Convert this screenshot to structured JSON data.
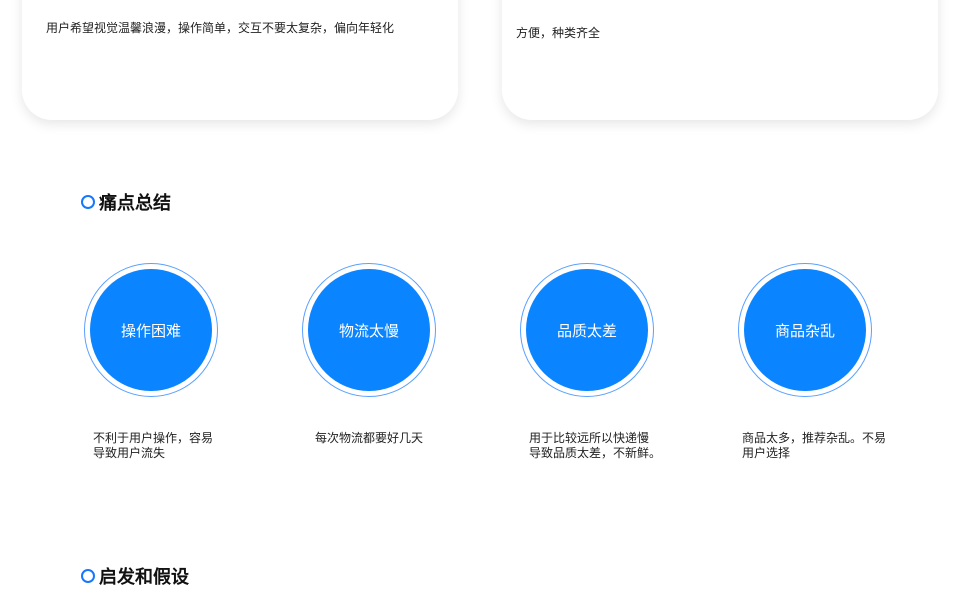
{
  "cards": {
    "left_text": "用户希望视觉温馨浪漫，操作简单，交互不要太复杂，偏向年轻化",
    "right_text": "方便，种类齐全"
  },
  "sections": {
    "pain_title": "痛点总结",
    "insight_title": "启发和假设"
  },
  "pain_points": [
    {
      "label": "操作困难",
      "desc_line1": "不利于用户操作，容易",
      "desc_line2": "导致用户流失"
    },
    {
      "label": "物流太慢",
      "desc_line1": "每次物流都要好几天",
      "desc_line2": ""
    },
    {
      "label": "品质太差",
      "desc_line1": "用于比较远所以快递慢",
      "desc_line2": "导致品质太差，不新鲜。"
    },
    {
      "label": "商品杂乱",
      "desc_line1": "商品太多，推荐杂乱。不易",
      "desc_line2": "用户选择"
    }
  ],
  "colors": {
    "accent": "#0a84ff",
    "ring": "#5aa0ff"
  },
  "icons": {
    "section_marker": "circle-outline-icon"
  }
}
